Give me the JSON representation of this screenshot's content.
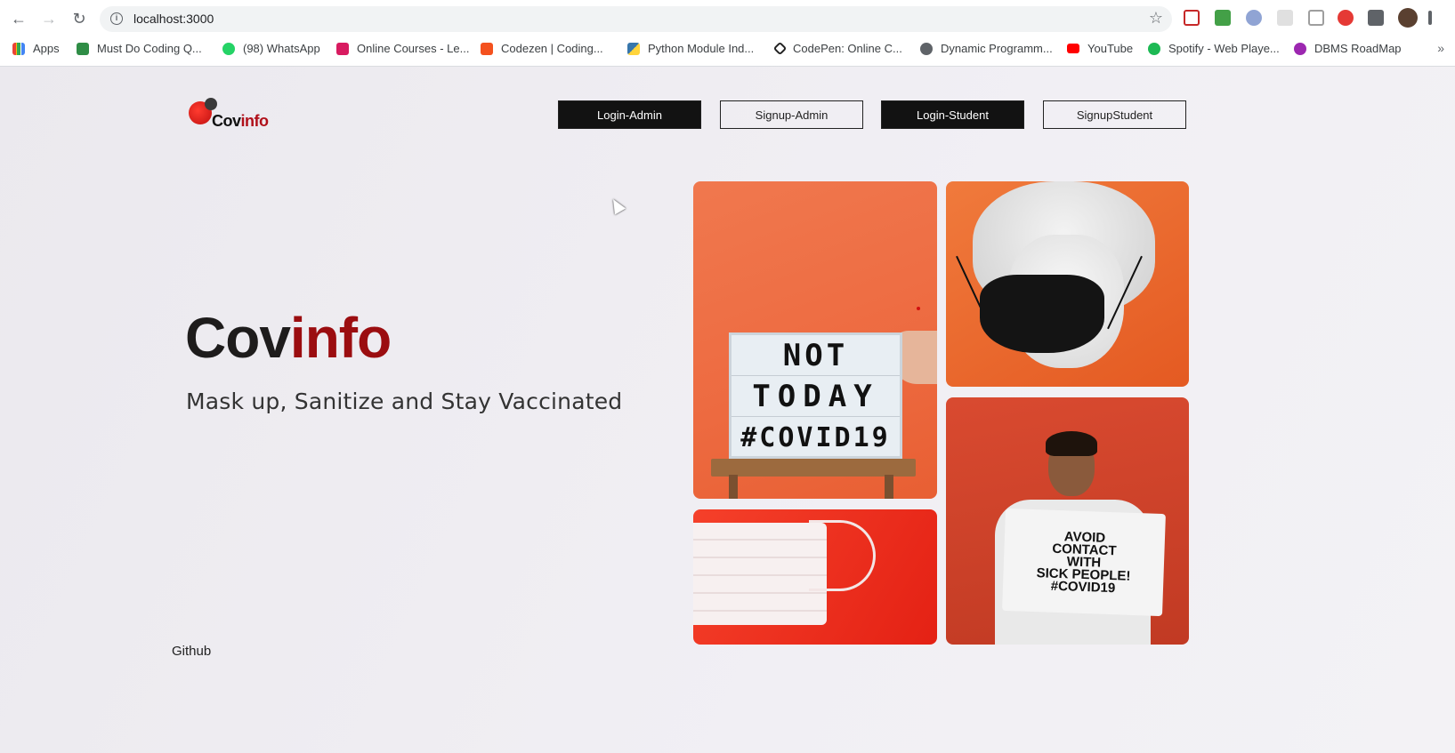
{
  "browser": {
    "url": "localhost:3000",
    "bookmarks": [
      {
        "label": "Apps",
        "color": "#ea4335"
      },
      {
        "label": "Must Do Coding Q...",
        "color": "#2f8d46"
      },
      {
        "label": "(98) WhatsApp",
        "color": "#25d366"
      },
      {
        "label": "Online Courses - Le...",
        "color": "#d81b60"
      },
      {
        "label": "Codezen | Coding...",
        "color": "#f4511e"
      },
      {
        "label": "Python Module Ind...",
        "color": "#3776ab"
      },
      {
        "label": "CodePen: Online C...",
        "color": "#222222"
      },
      {
        "label": "Dynamic Programm...",
        "color": "#5f6368"
      },
      {
        "label": "YouTube",
        "color": "#ff0000"
      },
      {
        "label": "Spotify - Web Playe...",
        "color": "#1db954"
      },
      {
        "label": "DBMS RoadMap",
        "color": "#9c27b0"
      }
    ],
    "more_label": "»"
  },
  "header": {
    "logo_text_dark": "Cov",
    "logo_text_red": "info",
    "buttons": [
      {
        "label": "Login-Admin",
        "style": "dark"
      },
      {
        "label": "Signup-Admin",
        "style": "light"
      },
      {
        "label": "Login-Student",
        "style": "dark"
      },
      {
        "label": "SignupStudent",
        "style": "light"
      }
    ]
  },
  "hero": {
    "title_dark": "Cov",
    "title_red": "info",
    "subtitle": "Mask up, Sanitize and Stay Vaccinated",
    "title_red_color": "#9b0d10"
  },
  "footer": {
    "github_label": "Github"
  },
  "gallery": {
    "board_lines": [
      "NOT",
      "TODAY",
      "#COVID19"
    ],
    "sign_lines": [
      "AVOID",
      "CONTACT",
      "WITH",
      "SICK PEOPLE!",
      "#COVID19"
    ]
  }
}
